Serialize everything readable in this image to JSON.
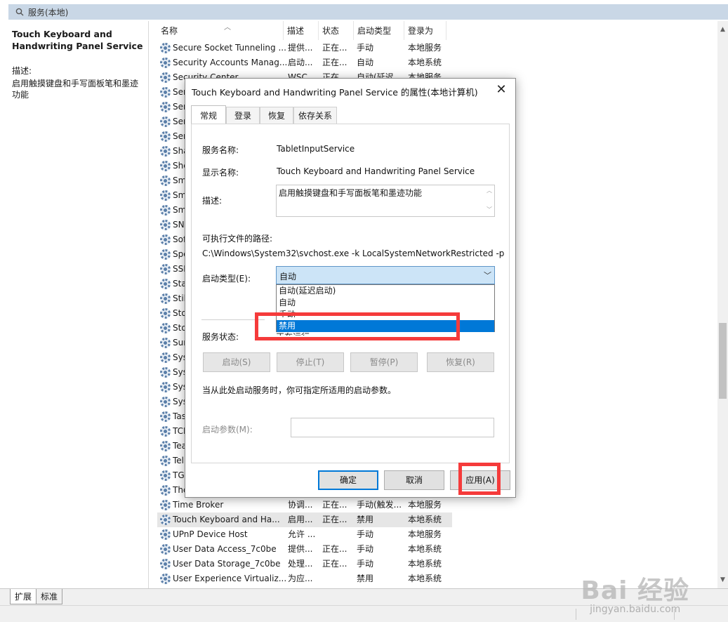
{
  "window": {
    "title": "服务(本地)"
  },
  "left_pane": {
    "title": "Touch Keyboard and Handwriting Panel Service",
    "desc_label": "描述:",
    "desc": "启用触摸键盘和手写面板笔和墨迹功能"
  },
  "columns": [
    "名称",
    "描述",
    "状态",
    "启动类型",
    "登录为"
  ],
  "rows": [
    [
      "Secure Socket Tunneling ...",
      "提供...",
      "正在...",
      "手动",
      "本地服务"
    ],
    [
      "Security Accounts Manag...",
      "启动...",
      "正在...",
      "自动",
      "本地系统"
    ],
    [
      "Security Center",
      "WSC...",
      "正在...",
      "自动(延迟...",
      "本地服务"
    ],
    [
      "Ser",
      "",
      "",
      "",
      ""
    ],
    [
      "Ser",
      "",
      "",
      "",
      ""
    ],
    [
      "Ser",
      "",
      "",
      "",
      ""
    ],
    [
      "Ser",
      "",
      "",
      "",
      ""
    ],
    [
      "Sha",
      "",
      "",
      "",
      ""
    ],
    [
      "She",
      "",
      "",
      "",
      ""
    ],
    [
      "Sm",
      "",
      "",
      "",
      ""
    ],
    [
      "Sm",
      "",
      "",
      "",
      ""
    ],
    [
      "Sm",
      "",
      "",
      "",
      ""
    ],
    [
      "SN",
      "",
      "",
      "",
      ""
    ],
    [
      "Sof",
      "",
      "",
      "",
      ""
    ],
    [
      "Spo",
      "",
      "",
      "",
      ""
    ],
    [
      "SSD",
      "",
      "",
      "",
      ""
    ],
    [
      "Sta",
      "",
      "",
      "",
      ""
    ],
    [
      "Stil",
      "",
      "",
      "",
      ""
    ],
    [
      "Sto",
      "",
      "",
      "",
      ""
    ],
    [
      "Sto",
      "",
      "",
      "",
      ""
    ],
    [
      "Sur",
      "",
      "",
      "",
      ""
    ],
    [
      "Sys",
      "",
      "",
      "",
      ""
    ],
    [
      "Sys",
      "",
      "",
      "",
      ""
    ],
    [
      "Sys",
      "",
      "",
      "",
      ""
    ],
    [
      "Sys",
      "",
      "",
      "",
      ""
    ],
    [
      "Tas",
      "",
      "",
      "",
      ""
    ],
    [
      "TCP",
      "",
      "",
      "",
      ""
    ],
    [
      "Tea",
      "",
      "",
      "",
      ""
    ],
    [
      "Tel",
      "",
      "",
      "",
      ""
    ],
    [
      "TG",
      "",
      "",
      "",
      ""
    ],
    [
      "The",
      "",
      "",
      "",
      ""
    ],
    [
      "Time Broker",
      "协调...",
      "正在...",
      "手动(触发...",
      "本地服务"
    ],
    [
      "Touch Keyboard and Ha...",
      "启用...",
      "正在...",
      "禁用",
      "本地系统"
    ],
    [
      "UPnP Device Host",
      "允许 ...",
      "",
      "手动",
      "本地服务"
    ],
    [
      "User Data Access_7c0be",
      "提供...",
      "正在...",
      "手动",
      "本地系统"
    ],
    [
      "User Data Storage_7c0be",
      "处理...",
      "正在...",
      "手动",
      "本地系统"
    ],
    [
      "User Experience Virtualiz...",
      "为应...",
      "",
      "禁用",
      "本地系统"
    ]
  ],
  "selected_row": 32,
  "bottom_tabs": [
    "扩展",
    "标准"
  ],
  "watermark": {
    "logo": "Bai 经验",
    "url": "jingyan.baidu.com"
  },
  "dialog": {
    "title": "Touch Keyboard and Handwriting Panel Service 的属性(本地计算机)",
    "close": "✕",
    "tabs": [
      "常规",
      "登录",
      "恢复",
      "依存关系"
    ],
    "service_name_label": "服务名称:",
    "service_name": "TabletInputService",
    "display_name_label": "显示名称:",
    "display_name": "Touch Keyboard and Handwriting Panel Service",
    "desc_label": "描述:",
    "desc": "启用触摸键盘和手写面板笔和墨迹功能",
    "path_label": "可执行文件的路径:",
    "path": "C:\\Windows\\System32\\svchost.exe -k LocalSystemNetworkRestricted -p",
    "startup_label": "启动类型(E):",
    "startup_value": "自动",
    "options": [
      "自动(延迟启动)",
      "自动",
      "手动",
      "禁用"
    ],
    "status_label": "服务状态:",
    "status_value": "正在运行",
    "start_btn": "启动(S)",
    "stop_btn": "停止(T)",
    "pause_btn": "暂停(P)",
    "resume_btn": "恢复(R)",
    "hint": "当从此处启动服务时，你可指定所适用的启动参数。",
    "param_label": "启动参数(M):",
    "ok": "确定",
    "cancel": "取消",
    "apply": "应用(A)"
  },
  "colors": {
    "highlight": "#f53b3b",
    "selection": "#0078d7"
  }
}
